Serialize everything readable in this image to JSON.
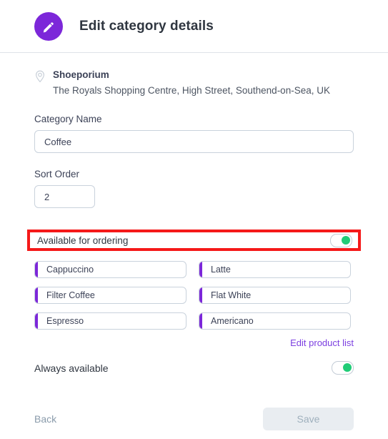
{
  "header": {
    "icon": "pencil-edit-icon",
    "title": "Edit category details",
    "icon_bg": "#7c27d9"
  },
  "location": {
    "icon": "map-pin-icon",
    "name": "Shoeporium",
    "address": "The Royals Shopping Centre, High Street, Southend-on-Sea, UK"
  },
  "form": {
    "category_name": {
      "label": "Category Name",
      "value": "Coffee",
      "placeholder": "Category Name"
    },
    "sort_order": {
      "label": "Sort Order",
      "value": "2",
      "placeholder": "0"
    }
  },
  "available_for_ordering": {
    "label": "Available for ordering",
    "enabled": true,
    "highlight_color": "#f51919",
    "toggle_on_color": "#21cc77"
  },
  "products": [
    {
      "name": "Cappuccino"
    },
    {
      "name": "Latte"
    },
    {
      "name": "Filter Coffee"
    },
    {
      "name": "Flat White"
    },
    {
      "name": "Espresso"
    },
    {
      "name": "Americano"
    }
  ],
  "edit_product_list": {
    "label": "Edit product list",
    "color": "#7c3fe0"
  },
  "always_available": {
    "label": "Always available",
    "enabled": true,
    "toggle_on_color": "#21cc77"
  },
  "footer": {
    "back_label": "Back",
    "save_label": "Save",
    "save_disabled": true
  }
}
